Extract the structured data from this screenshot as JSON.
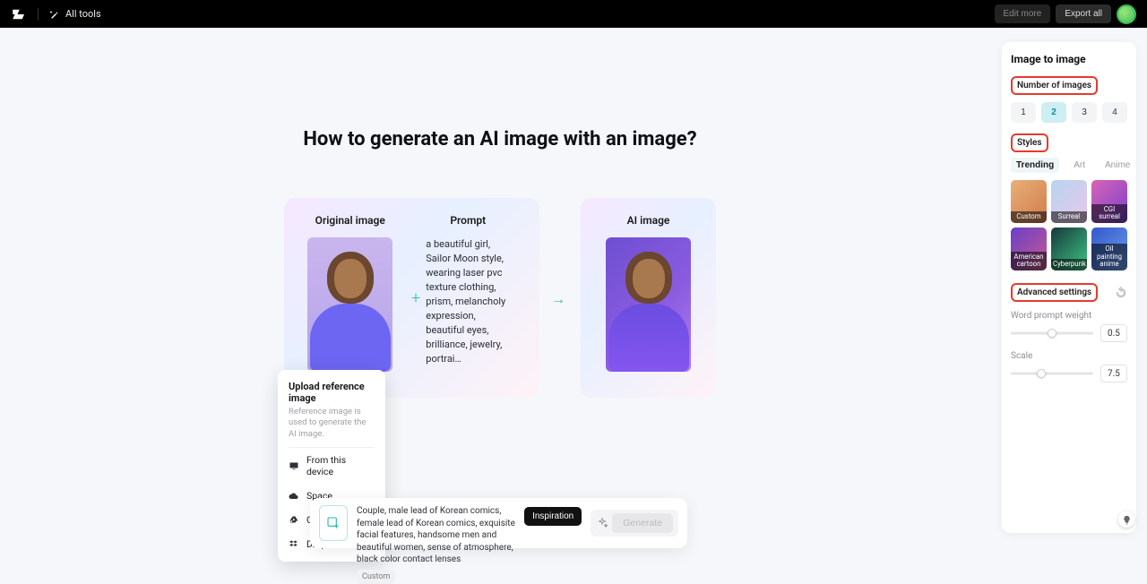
{
  "topbar": {
    "all_tools": "All tools",
    "edit_more": "Edit more",
    "export_all": "Export all"
  },
  "headline": "How to generate an AI image with an image?",
  "card": {
    "original_label": "Original image",
    "prompt_label": "Prompt",
    "ai_label": "AI image",
    "prompt_text": "a beautiful girl, Sailor Moon style, wearing laser pvc texture clothing, prism, melancholy expression, beautiful eyes, brilliance, jewelry, portrai…"
  },
  "upload_popover": {
    "title": "Upload reference image",
    "subtitle": "Reference image is used to generate the AI image.",
    "items": [
      "From this device",
      "Space",
      "Google Drive",
      "Dropbox"
    ]
  },
  "prompt_bar": {
    "text": "Couple, male lead of Korean comics, female lead of Korean comics, exquisite facial features, handsome men and beautiful women, sense of atmosphere, black color contact lenses",
    "chip": "Custom",
    "inspiration": "Inspiration",
    "generate": "Generate"
  },
  "panel": {
    "title": "Image to image",
    "num_label": "Number of images",
    "numbers": [
      "1",
      "2",
      "3",
      "4"
    ],
    "num_active": "2",
    "styles_label": "Styles",
    "style_tabs": [
      "Trending",
      "Art",
      "Anime"
    ],
    "style_tab_active": "Trending",
    "styles": [
      "Custom",
      "Surreal",
      "CGI surreal",
      "American cartoon",
      "Cyberpunk",
      "Oil painting anime"
    ],
    "adv_label": "Advanced settings",
    "weight_label": "Word prompt weight",
    "weight_value": "0.5",
    "scale_label": "Scale",
    "scale_value": "7.5"
  }
}
